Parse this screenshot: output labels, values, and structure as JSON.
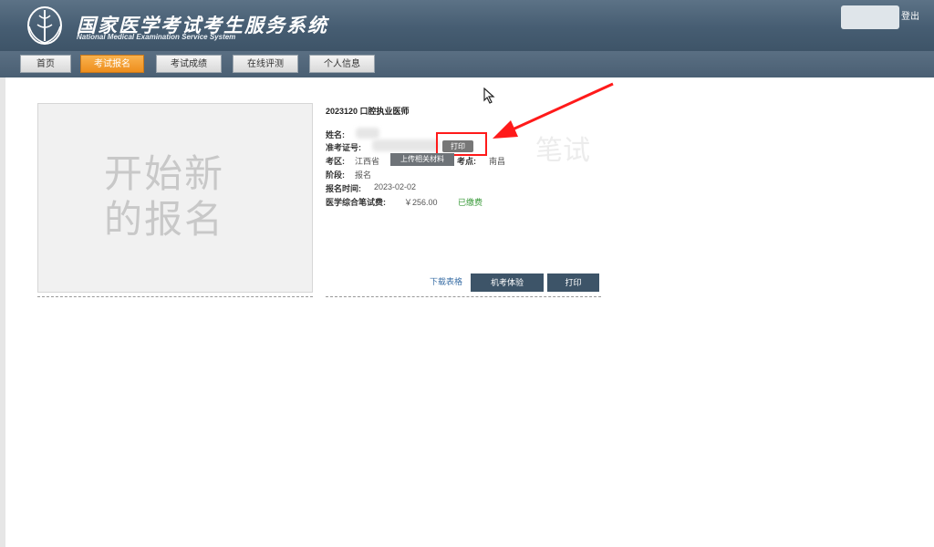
{
  "header": {
    "title": "国家医学考试考生服务系统",
    "subtitle": "National Medical Examination Service System",
    "logout_label": "登出"
  },
  "nav": {
    "items": [
      {
        "label": "首页",
        "active": false
      },
      {
        "label": "考试报名",
        "active": true
      },
      {
        "label": "考试成绩",
        "active": false
      },
      {
        "label": "在线评测",
        "active": false
      },
      {
        "label": "个人信息",
        "active": false
      }
    ]
  },
  "new_registration": {
    "label": "开始新的报名"
  },
  "exam_card": {
    "title": "2023120 口腔执业医师",
    "name_label": "姓名:",
    "ticket_label": "准考证号:",
    "print_small_label": "打印",
    "area_label": "考区:",
    "area_value": "江西省",
    "upload_label": "上传相关材料",
    "site_label": "考点:",
    "site_value": "南昌",
    "stage_label": "阶段:",
    "stage_value": "报名",
    "time_label": "报名时间:",
    "time_value": "2023-02-02",
    "fee_label": "医学综合笔试费:",
    "fee_value": "￥256.00",
    "fee_status": "已缴费",
    "ghost_label": "笔试",
    "download_label": "下载表格",
    "cbt_label": "机考体验",
    "print_label": "打印"
  },
  "colors": {
    "header_bg": "#465d72",
    "active_tab": "#ee8e1d",
    "dark_button": "#3d5468",
    "annotation_red": "#ff1a1a",
    "paid_green": "#3a9a3a"
  }
}
